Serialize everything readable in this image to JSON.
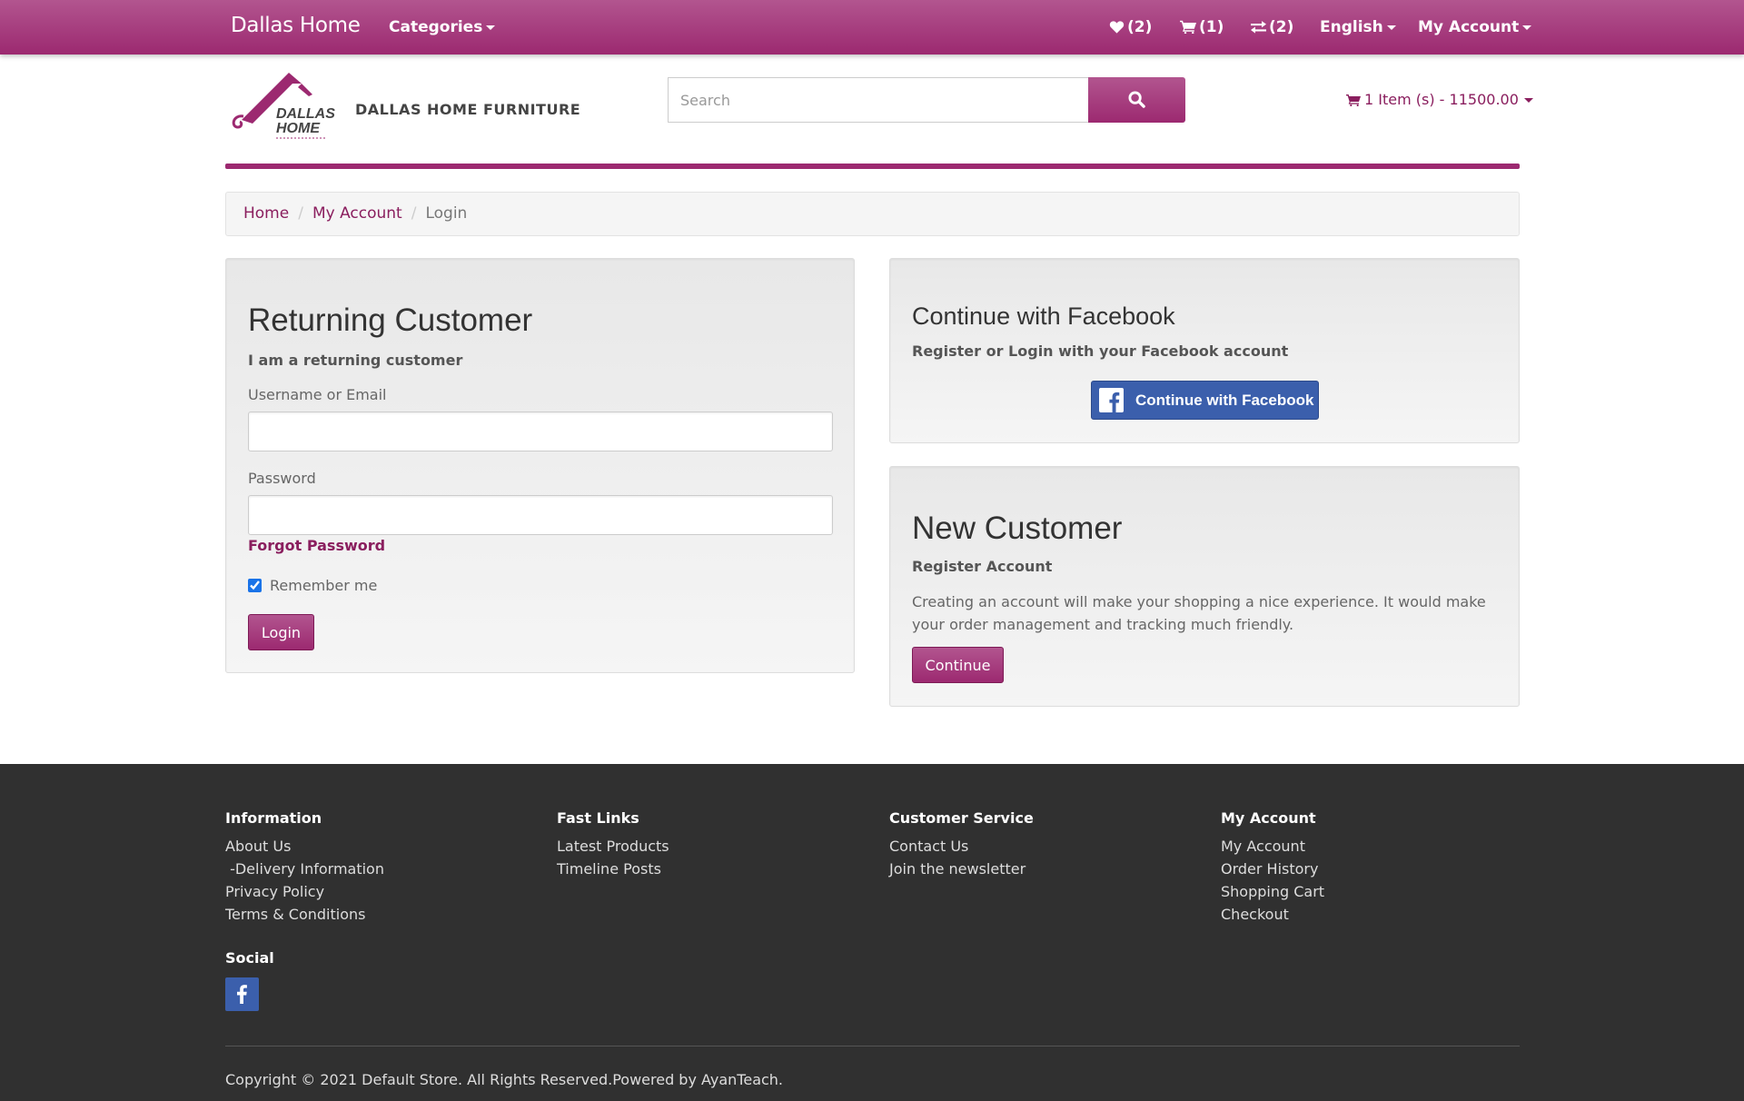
{
  "navbar": {
    "brand": "Dallas Home",
    "categories_label": "Categories",
    "wishlist_count": "(2)",
    "cart_count": "(1)",
    "compare_count": "(2)",
    "language": "English",
    "account_label": "My Account"
  },
  "header": {
    "logo_text_line1": "DALLAS",
    "logo_text_line2": "HOME",
    "store_name": "DALLAS HOME FURNITURE",
    "search_placeholder": "Search",
    "cart_summary": "1 Item (s) - 11500.00"
  },
  "breadcrumb": {
    "items": [
      "Home",
      "My Account",
      "Login"
    ]
  },
  "login": {
    "title": "Returning Customer",
    "subtitle": "I am a returning customer",
    "username_label": "Username or Email",
    "username_value": "",
    "password_label": "Password",
    "password_value": "",
    "forgot_label": "Forgot Password",
    "remember_label": "Remember me",
    "remember_checked": true,
    "login_button": "Login"
  },
  "facebook": {
    "title": "Continue with Facebook",
    "subtitle": "Register or Login with your Facebook account",
    "button_label": "Continue with Facebook"
  },
  "register": {
    "title": "New Customer",
    "subtitle": "Register Account",
    "description": "Creating an account will make your shopping a nice experience. It would make your order management and tracking much friendly.",
    "continue_button": "Continue"
  },
  "footer": {
    "columns": [
      {
        "heading": "Information",
        "links": [
          "About Us",
          " -Delivery Information",
          "Privacy Policy",
          "Terms & Conditions"
        ]
      },
      {
        "heading": "Fast Links",
        "links": [
          "Latest Products",
          "Timeline Posts"
        ]
      },
      {
        "heading": "Customer Service",
        "links": [
          "Contact Us",
          "Join the newsletter"
        ]
      },
      {
        "heading": "My Account",
        "links": [
          "My Account",
          "Order History",
          "Shopping Cart",
          "Checkout"
        ]
      }
    ],
    "social_heading": "Social",
    "copyright": "Copyright © 2021 Default Store. All Rights Reserved.Powered by AyanTeach."
  },
  "colors": {
    "brand": "#9c2970",
    "brand_light": "#b2558f",
    "facebook": "#3b5fac",
    "footer_bg": "#303030"
  },
  "icons": [
    "heart-icon",
    "cart-icon",
    "compare-icon",
    "search-icon",
    "facebook-icon"
  ]
}
